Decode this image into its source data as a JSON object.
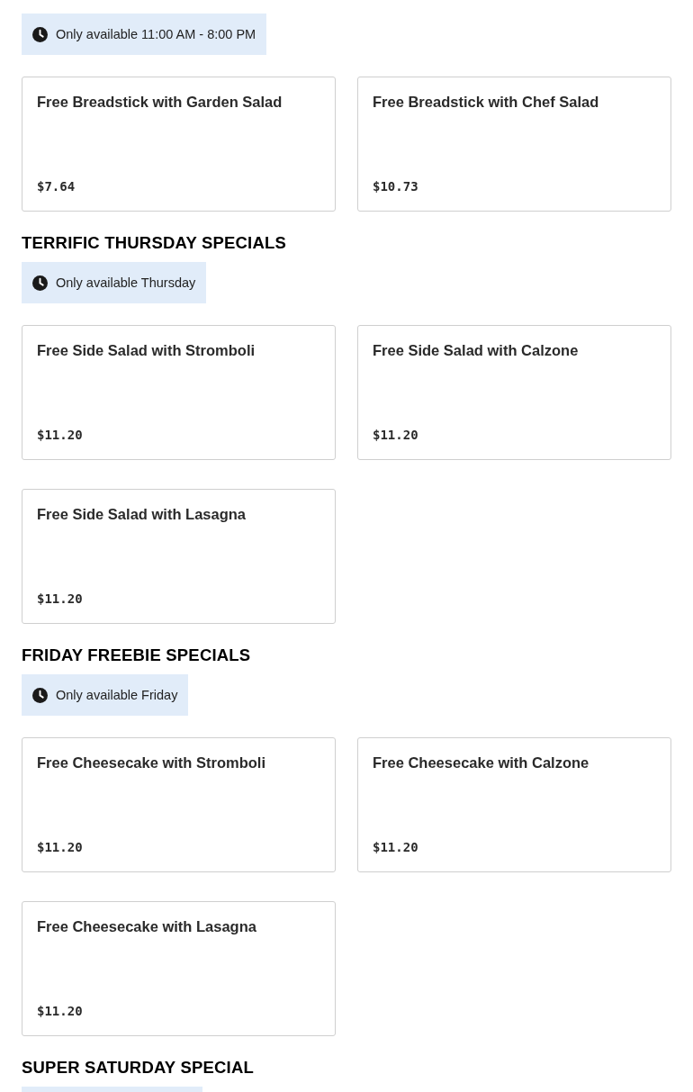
{
  "sections": [
    {
      "availability": "Only available 11:00 AM - 8:00 PM",
      "items": [
        {
          "name": "Free Breadstick with Garden Salad",
          "price": "$7.64"
        },
        {
          "name": "Free Breadstick with Chef Salad",
          "price": "$10.73"
        }
      ]
    },
    {
      "title": "TERRIFIC THURSDAY SPECIALS",
      "availability": "Only available Thursday",
      "items": [
        {
          "name": "Free Side Salad with Stromboli",
          "price": "$11.20"
        },
        {
          "name": "Free Side Salad with Calzone",
          "price": "$11.20"
        },
        {
          "name": "Free Side Salad with Lasagna",
          "price": "$11.20"
        }
      ]
    },
    {
      "title": "FRIDAY FREEBIE SPECIALS",
      "availability": "Only available Friday",
      "items": [
        {
          "name": "Free Cheesecake with Stromboli",
          "price": "$11.20"
        },
        {
          "name": "Free Cheesecake with Calzone",
          "price": "$11.20"
        },
        {
          "name": "Free Cheesecake with Lasagna",
          "price": "$11.20"
        }
      ]
    },
    {
      "title": "SUPER SATURDAY SPECIAL"
    }
  ]
}
